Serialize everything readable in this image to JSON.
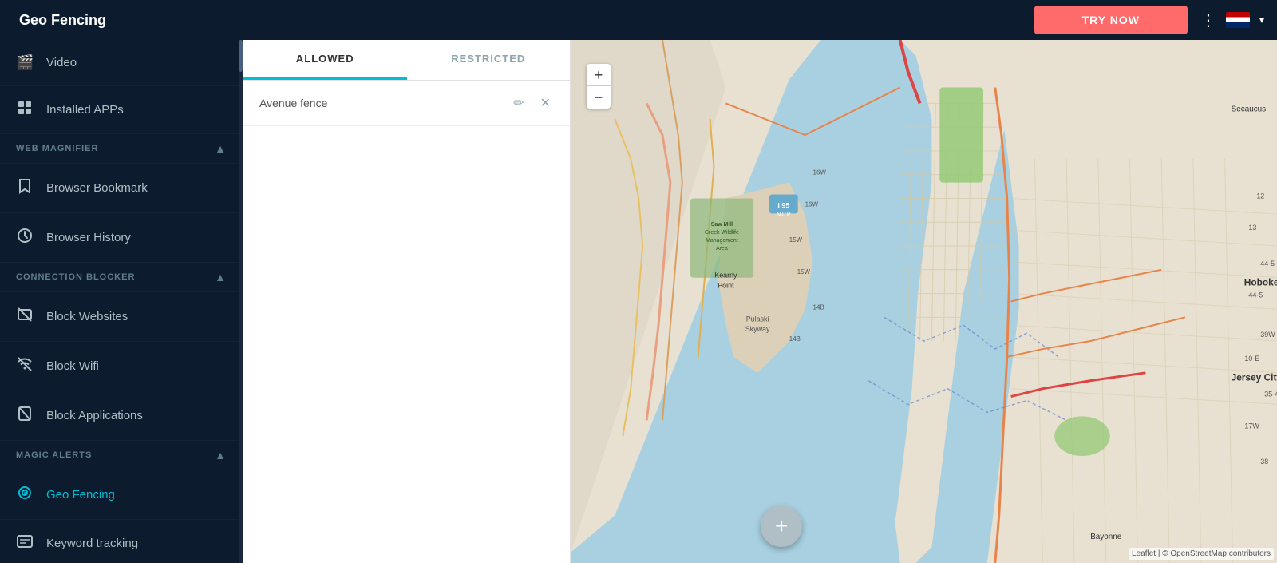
{
  "topbar": {
    "title": "Geo Fencing",
    "try_now_label": "TRY NOW"
  },
  "sidebar": {
    "sections": [
      {
        "items": [
          {
            "id": "video",
            "label": "Video",
            "icon": "🎬"
          },
          {
            "id": "installed-apps",
            "label": "Installed APPs",
            "icon": "⊞"
          }
        ]
      },
      {
        "header": "WEB MAGNIFIER",
        "collapsible": true,
        "items": [
          {
            "id": "browser-bookmark",
            "label": "Browser Bookmark",
            "icon": "🔖"
          },
          {
            "id": "browser-history",
            "label": "Browser History",
            "icon": "🕐"
          }
        ]
      },
      {
        "header": "CONNECTION BLOCKER",
        "collapsible": true,
        "items": [
          {
            "id": "block-websites",
            "label": "Block Websites",
            "icon": "🚫"
          },
          {
            "id": "block-wifi",
            "label": "Block Wifi",
            "icon": "📶"
          },
          {
            "id": "block-applications",
            "label": "Block Applications",
            "icon": "📵"
          }
        ]
      },
      {
        "header": "MAGIC ALERTS",
        "collapsible": true,
        "items": [
          {
            "id": "geo-fencing",
            "label": "Geo Fencing",
            "icon": "◎",
            "active": true
          },
          {
            "id": "keyword-tracking",
            "label": "Keyword tracking",
            "icon": "⌨"
          }
        ]
      }
    ]
  },
  "left_panel": {
    "tabs": [
      {
        "id": "allowed",
        "label": "ALLOWED",
        "active": true
      },
      {
        "id": "restricted",
        "label": "RESTRICTED",
        "active": false
      }
    ],
    "fence_items": [
      {
        "name": "Avenue fence"
      }
    ],
    "add_button_label": "+"
  },
  "map": {
    "zoom_plus": "+",
    "zoom_minus": "−",
    "attribution": "Leaflet | © OpenStreetMap contributors"
  }
}
